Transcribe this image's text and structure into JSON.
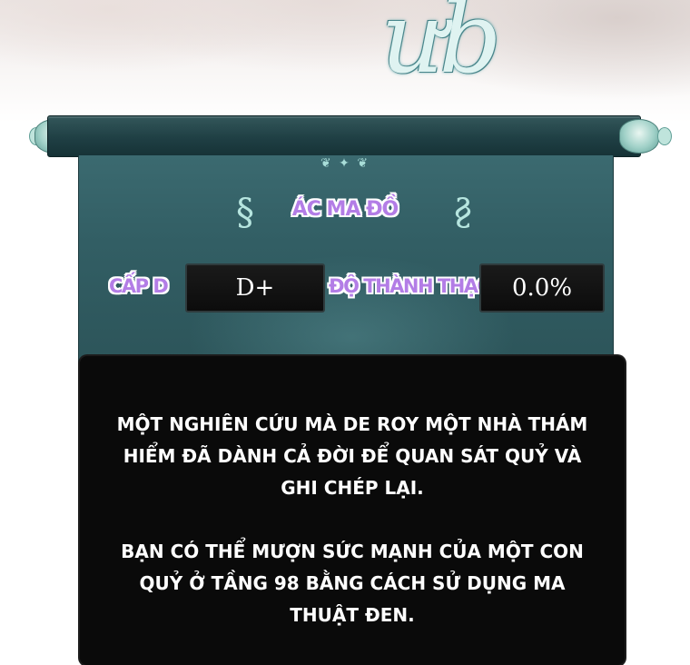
{
  "header": {
    "glyph": "ưb"
  },
  "scroll": {
    "title": "ÁC MA ĐỒ",
    "rank_label": "CẤP D",
    "rank_value": "D+",
    "proficiency_label": "ĐỘ THÀNH THẠO",
    "proficiency_value": "0.0%",
    "ornament_icon": "scroll-ornament-icon",
    "colors": {
      "banner": "#325e64",
      "label": "#b37de6",
      "value_box": "#111111"
    }
  },
  "description": {
    "paragraph_1": "MỘT NGHIÊN CỨU MÀ DE ROY MỘT NHÀ THÁM HIỂM ĐÃ DÀNH CẢ ĐỜI ĐỂ QUAN SÁT QUỶ VÀ GHI CHÉP LẠI.",
    "paragraph_2": "BẠN CÓ THỂ MƯỢN SỨC MẠNH CỦA MỘT CON QUỶ Ở TẦNG 98 BẰNG CÁCH SỬ DỤNG MA THUẬT ĐEN."
  }
}
